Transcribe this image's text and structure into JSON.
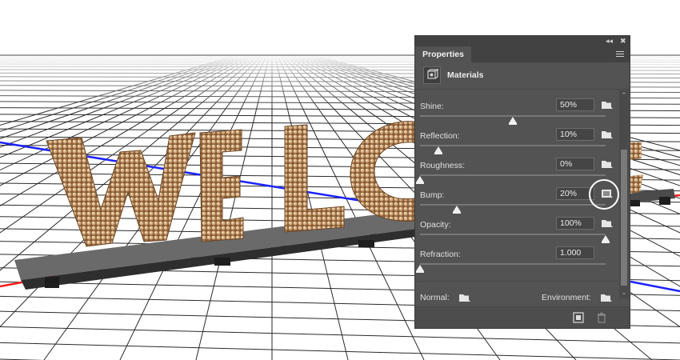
{
  "panel": {
    "collapse_glyph": "◂◂",
    "close_glyph": "✖",
    "tab_label": "Properties",
    "header_label": "Materials",
    "rows": [
      {
        "label": "Shine:",
        "value": "50%",
        "slider": 0.5
      },
      {
        "label": "Reflection:",
        "value": "10%",
        "slider": 0.1
      },
      {
        "label": "Roughness:",
        "value": "0%",
        "slider": 0.0
      },
      {
        "label": "Bump:",
        "value": "20%",
        "slider": 0.2
      },
      {
        "label": "Opacity:",
        "value": "100%",
        "slider": 1.0
      },
      {
        "label": "Refraction:",
        "value": "1.000",
        "slider": 0.0
      }
    ],
    "normal_label": "Normal:",
    "environment_label": "Environment:",
    "icons": [
      "materials-icon",
      "folder-icon",
      "new-texture-icon",
      "trash-icon",
      "panel-menu-icon"
    ]
  },
  "scene": {
    "text": "WELC",
    "letter_color": "#c49a6c",
    "base_color": "#5a5a5a",
    "axis_colors": {
      "x": "#ff0000",
      "z": "#0000ff"
    }
  }
}
